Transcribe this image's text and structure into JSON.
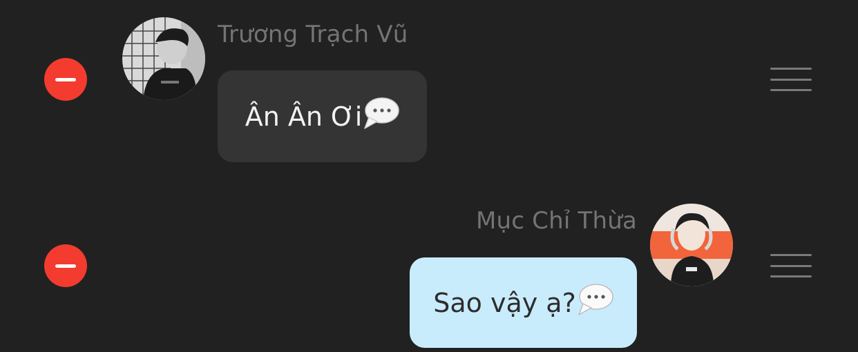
{
  "messages": [
    {
      "sender": "Trương Trạch Vũ",
      "text": "Ân Ân Ơi",
      "side": "left",
      "bubble_color": "#343434",
      "icon": "speech-balloon-icon"
    },
    {
      "sender": "Mục Chỉ Thừa",
      "text": "Sao vậy ạ?",
      "side": "right",
      "bubble_color": "#c9ecfc",
      "icon": "speech-balloon-icon"
    }
  ],
  "colors": {
    "background": "#212121",
    "delete": "#f43b2f",
    "handle": "#7a7a7a",
    "sender_name": "#747474"
  },
  "icons": {
    "delete": "minus-circle-icon",
    "reorder": "drag-handle-icon"
  }
}
